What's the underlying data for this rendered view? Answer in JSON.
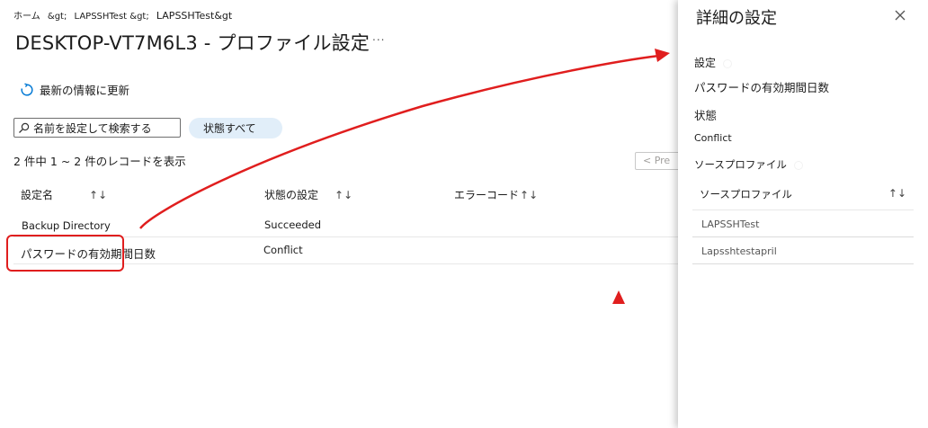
{
  "breadcrumb": {
    "home": "ホーム",
    "sep1": "&gt;",
    "item1": "LAPSSHTest &gt;",
    "item2": "LAPSSHTest&gt"
  },
  "page": {
    "title": "DESKTOP-VT7M6L3 - プロファイル設定",
    "more": "..."
  },
  "toolbar": {
    "refresh_label": "最新の情報に更新"
  },
  "filters": {
    "search_placeholder": "名前を設定して検索する",
    "status_filter": "状態すべて"
  },
  "record_count": "2 件中 1 ~ 2 件のレコードを表示",
  "pagination": {
    "prev_label": "< Pre"
  },
  "table": {
    "columns": [
      "設定名",
      "状態の設定",
      "エラーコード"
    ],
    "rows": [
      {
        "setting": "Backup Directory",
        "state": "Succeeded",
        "error": ""
      },
      {
        "setting": "パスワードの有効期間日数",
        "state": "Conflict",
        "error": ""
      }
    ]
  },
  "panel": {
    "title": "詳細の設定",
    "setting_label": "設定",
    "setting_value": "パスワードの有効期間日数",
    "state_label": "状態",
    "state_value": "Conflict",
    "source_label": "ソースプロファイル",
    "table_header": "ソースプロファイル",
    "sources": [
      "LAPSSHTest",
      "Lapsshtestapril"
    ]
  },
  "colors": {
    "annotation_red": "#e01e1e",
    "accent_blue": "#0078d4",
    "pill_bg": "#e1eef9"
  }
}
